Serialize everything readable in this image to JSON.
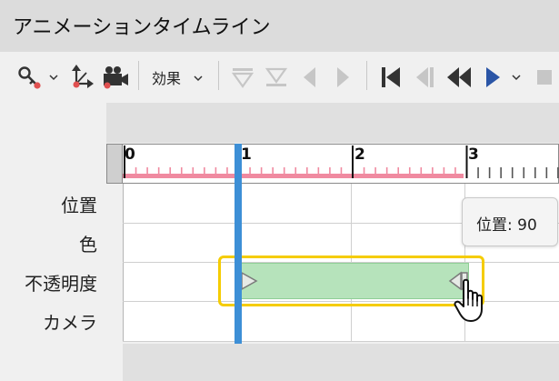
{
  "window": {
    "title": "アニメーションタイムライン"
  },
  "toolbar": {
    "effect_label": "効果",
    "icons": [
      "keyframe-icon",
      "motion-path-icon",
      "camera-icon",
      "effect-dropdown",
      "ease-in-icon",
      "ease-out-icon",
      "prev-keyframe-icon",
      "next-keyframe-icon",
      "go-to-start-icon",
      "step-back-icon",
      "rewind-icon",
      "play-icon",
      "stop-icon"
    ]
  },
  "ruler": {
    "labels": [
      "0",
      "1",
      "2",
      "3"
    ]
  },
  "tracks": [
    {
      "label": "位置"
    },
    {
      "label": "色"
    },
    {
      "label": "不透明度"
    },
    {
      "label": "カメラ"
    }
  ],
  "tooltip": {
    "text": "位置: 90"
  },
  "colors": {
    "clip_fill": "#b6e3bb",
    "highlight": "#f5cc00",
    "playhead": "#3d8fd6",
    "ruler_ticks": "#f08aa0",
    "play_button": "#2a55a6"
  }
}
